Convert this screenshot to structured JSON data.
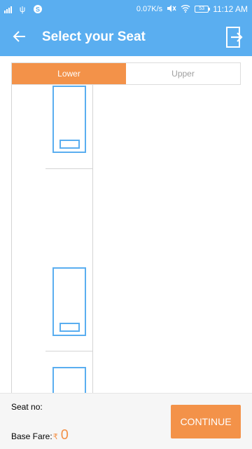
{
  "status_bar": {
    "net_speed": "0.07K/s",
    "battery": "53",
    "time": "11:12 AM",
    "icons": [
      "signal-icon",
      "usb-icon",
      "app-notification-icon",
      "mute-icon",
      "wifi-icon",
      "battery-icon"
    ]
  },
  "app_bar": {
    "title": "Select your Seat",
    "back_icon": "arrow-left-icon",
    "exit_icon": "exit-icon"
  },
  "tabs": [
    {
      "label": "Lower",
      "active": true
    },
    {
      "label": "Upper",
      "active": false
    }
  ],
  "bottom": {
    "seat_no_label": "Seat no:",
    "base_fare_label": "Base Fare:",
    "currency": "₹",
    "base_fare_value": "0",
    "continue_label": "CONTINUE"
  },
  "colors": {
    "primary": "#5aaef0",
    "accent": "#f39249"
  }
}
